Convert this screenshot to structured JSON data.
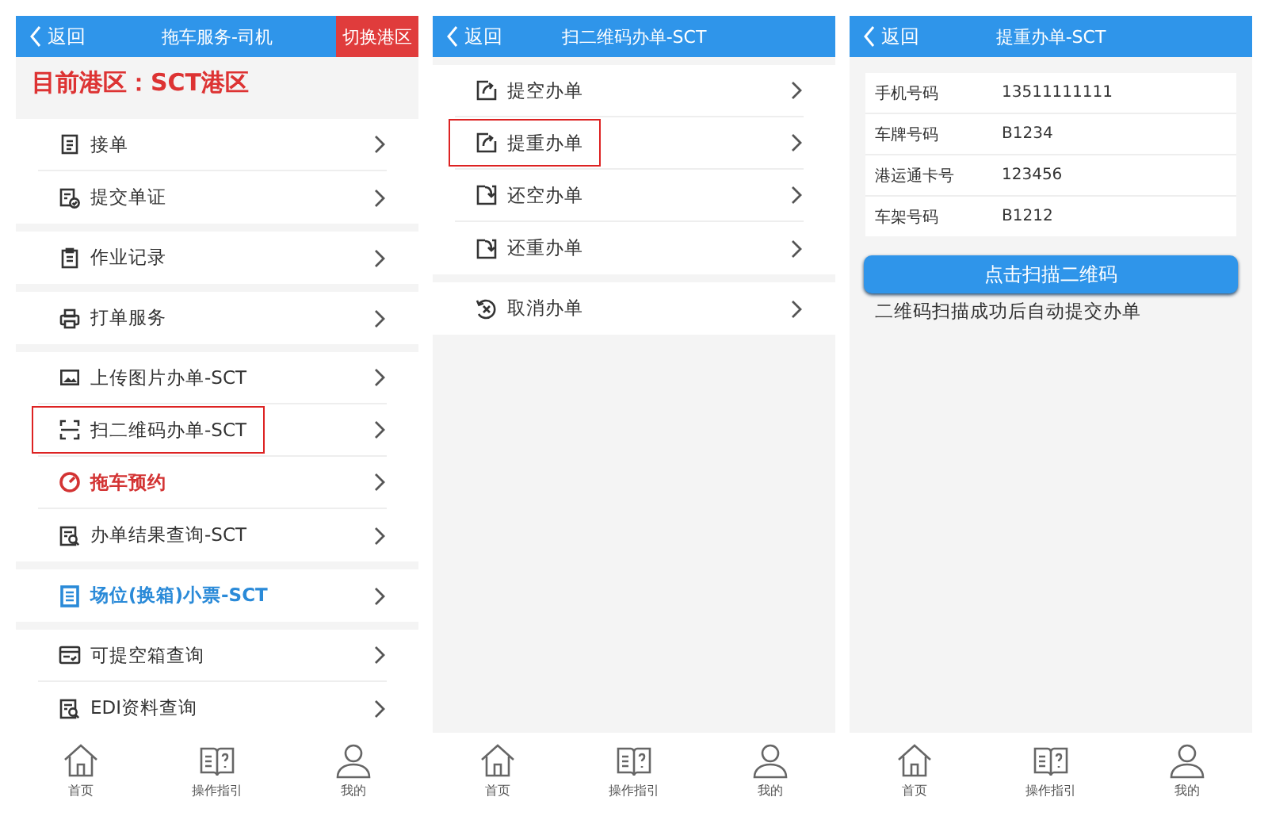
{
  "screens": [
    {
      "header": {
        "back": "返回",
        "title": "拖车服务-司机",
        "action": "切换港区"
      },
      "port_banner": "目前港区：SCT港区",
      "groups": [
        [
          {
            "label": "接单",
            "color": "#333333",
            "highlighted": false
          },
          {
            "label": "提交单证",
            "color": "#333333",
            "highlighted": false
          }
        ],
        [
          {
            "label": "作业记录",
            "color": "#333333",
            "highlighted": false
          }
        ],
        [
          {
            "label": "打单服务",
            "color": "#333333",
            "highlighted": false
          }
        ],
        [
          {
            "label": "上传图片办单-SCT",
            "color": "#333333",
            "highlighted": false
          },
          {
            "label": "扫二维码办单-SCT",
            "color": "#333333",
            "highlighted": true
          },
          {
            "label": "拖车预约",
            "color": "#d33333",
            "highlighted": false
          },
          {
            "label": "办单结果查询-SCT",
            "color": "#333333",
            "highlighted": false
          }
        ],
        [
          {
            "label": "场位(换箱)小票-**SCT**",
            "color": "#2a8ad8",
            "highlighted": false
          }
        ],
        [
          {
            "label": "可提空箱查询",
            "color": "#333333",
            "highlighted": false
          },
          {
            "label": "EDI资料查询",
            "color": "#333333",
            "highlighted": false
          }
        ]
      ],
      "tabbar": [
        "首页",
        "操作指引",
        "我的"
      ]
    },
    {
      "header": {
        "back": "返回",
        "title": "扫二维码办单-SCT"
      },
      "groups": [
        [
          {
            "label": "提空办单",
            "color": "#333333",
            "highlighted": false
          },
          {
            "label": "提重办单",
            "color": "#333333",
            "highlighted": true
          },
          {
            "label": "还空办单",
            "color": "#333333",
            "highlighted": false
          },
          {
            "label": "还重办单",
            "color": "#333333",
            "highlighted": false
          }
        ],
        [
          {
            "label": "取消办单",
            "color": "#333333",
            "highlighted": false
          }
        ]
      ],
      "tabbar": [
        "首页",
        "操作指引",
        "我的"
      ]
    },
    {
      "header": {
        "back": "返回",
        "title": "提重办单-SCT"
      },
      "form": [
        {
          "label": "手机号码",
          "value": "13511111111"
        },
        {
          "label": "车牌号码",
          "value": "B1234"
        },
        {
          "label": "港运通卡号",
          "value": "123456"
        },
        {
          "label": "车架号码",
          "value": "B1212"
        }
      ],
      "scan_button": "点击扫描二维码",
      "note": "二维码扫描成功后自动提交办单",
      "tabbar": [
        "首页",
        "操作指引",
        "我的"
      ]
    }
  ]
}
